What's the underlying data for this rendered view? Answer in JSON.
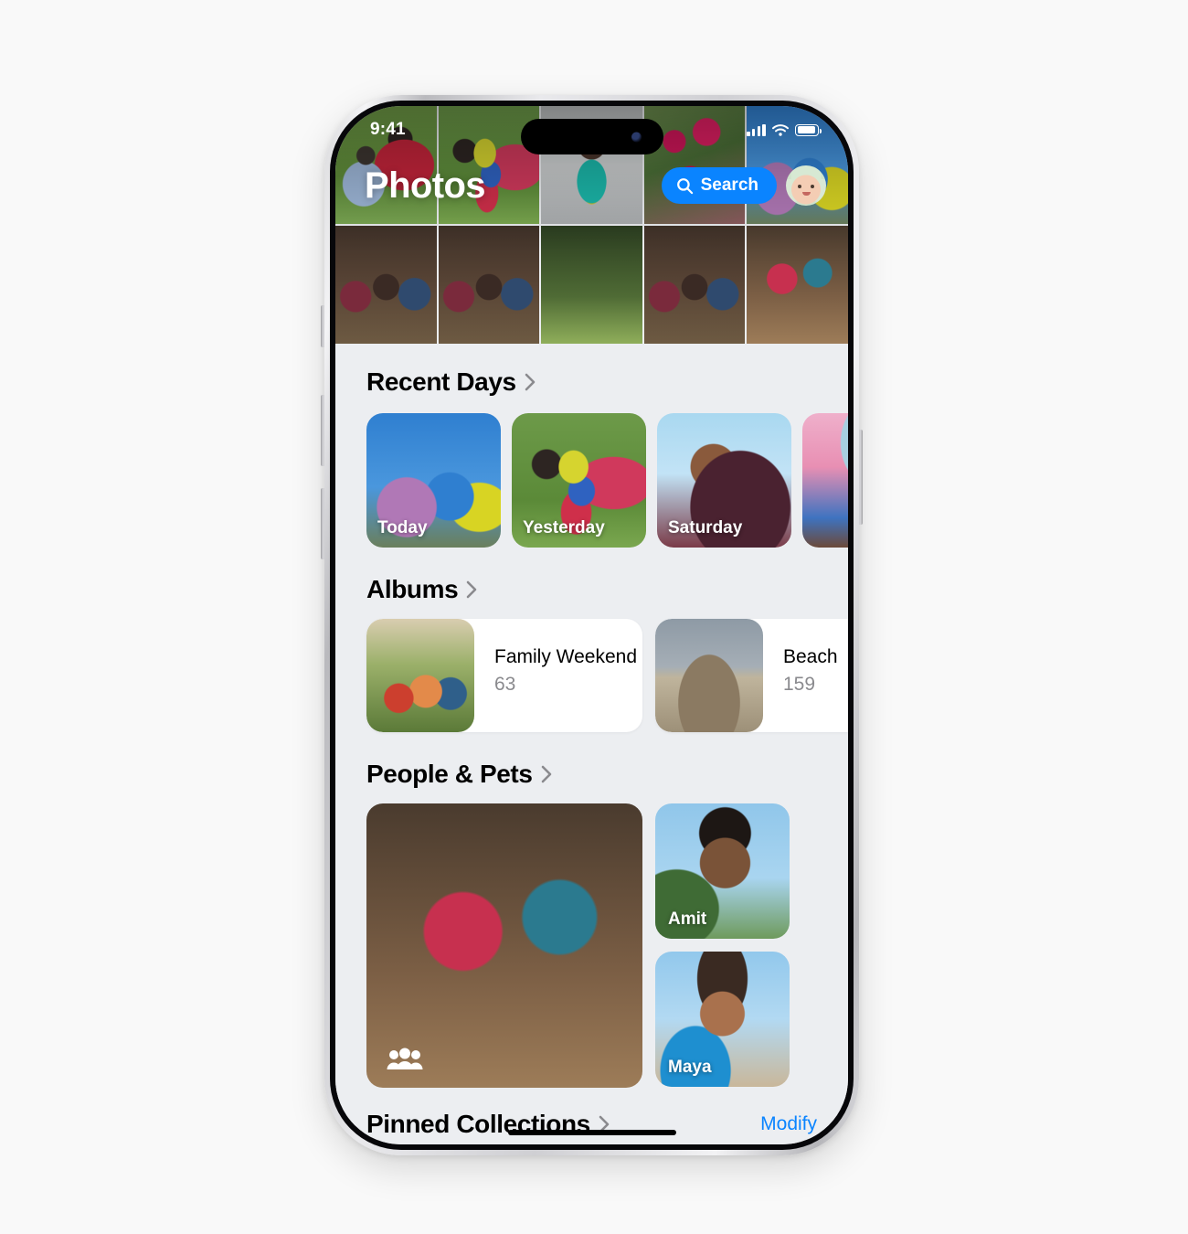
{
  "status_bar": {
    "time": "9:41",
    "cellular_icon": "signal-bars-icon",
    "wifi_icon": "wifi-icon",
    "battery_icon": "battery-icon"
  },
  "nav": {
    "title": "Photos",
    "search_label": "Search",
    "search_icon": "search-icon",
    "avatar_name": "memoji-avatar"
  },
  "sections": {
    "recent_days": {
      "title": "Recent Days",
      "chevron_icon": "chevron-right-icon",
      "tiles": [
        {
          "label": "Today",
          "art": "ph-sky"
        },
        {
          "label": "Yesterday",
          "art": "ph-kid2"
        },
        {
          "label": "Saturday",
          "art": "ph-saturday"
        },
        {
          "label": "",
          "art": "ph-purple"
        }
      ]
    },
    "albums": {
      "title": "Albums",
      "chevron_icon": "chevron-right-icon",
      "cards": [
        {
          "name": "Family Weekend",
          "count": "63",
          "art": "ph-field"
        },
        {
          "name": "Beach",
          "count": "159",
          "art": "ph-beach"
        }
      ]
    },
    "people_pets": {
      "title": "People & Pets",
      "chevron_icon": "chevron-right-icon",
      "group_icon": "people-group-icon",
      "featured_art": "ph-party",
      "tiles": [
        {
          "label": "Amit",
          "art": "ph-boy"
        },
        {
          "label": "Maya",
          "art": "ph-maya"
        }
      ]
    },
    "pinned_collections": {
      "title": "Pinned Collections",
      "chevron_icon": "chevron-right-icon",
      "action_label": "Modify"
    }
  },
  "hero_grid": {
    "cells": [
      "ph-kid1",
      "ph-kid2",
      "ph-girl",
      "ph-flowers",
      "ph-sky",
      "ph-crowd",
      "ph-crowd",
      "ph-green",
      "ph-crowd",
      "ph-party"
    ]
  },
  "colors": {
    "accent": "#0a84ff",
    "page_background": "#f9f9f9",
    "sheet_background": "#eceef1",
    "card_background": "#ffffff",
    "secondary_text": "#8a8a8e"
  }
}
